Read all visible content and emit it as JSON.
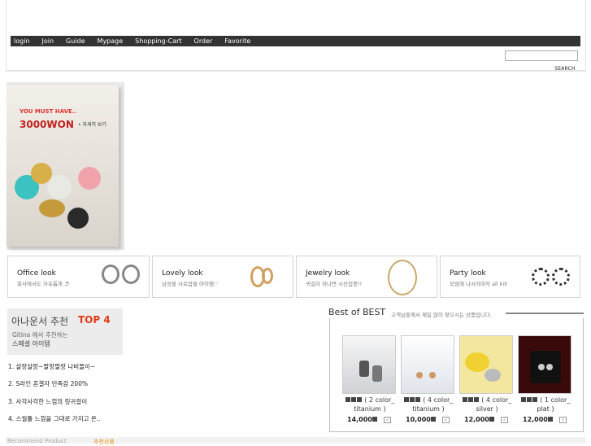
{
  "nav": {
    "items": [
      "login",
      "Join",
      "Guide",
      "Mypage",
      "Shopping-Cart",
      "Order",
      "Favorite"
    ]
  },
  "search": {
    "button_label": "SEARCH",
    "value": ""
  },
  "banner": {
    "tagline": "YOU MUST HAVE..",
    "price": "3000WON",
    "more": "• 자세히 보기"
  },
  "categories": [
    {
      "title": "Office look",
      "subtitle": "회사에서도 자유롭게 ♬"
    },
    {
      "title": "Lovely look",
      "subtitle": "남성을 사로잡을 아이템♡"
    },
    {
      "title": "Jewelry look",
      "subtitle": "귀걸이 하나면 시선집중!!"
    },
    {
      "title": "Party look",
      "subtitle": "모임에 나서자마자 all kill"
    }
  ],
  "announcer": {
    "title_a": "아나운서 추천",
    "title_b": "TOP 4",
    "sub1": "Gitina 에서 추천하는",
    "sub2": "스페셜 아이템",
    "items": [
      "1. 샬랑샬랑~팔랑팔랑 나비들이~",
      "2. S라인 흔결자 만족감 200%",
      "3. 사각사각한 느낌의 링귀걸이",
      "4. 스월톨 느낌을 그대로 가지고 온.."
    ]
  },
  "best": {
    "title": "Best of BEST",
    "subtitle": "고객님들께서 제일 많이 찾으시는 상품입니다.",
    "products": [
      {
        "name": "( 2 color_ titanium )",
        "price": "14,000"
      },
      {
        "name": "( 4 color_ titanium )",
        "price": "10,000"
      },
      {
        "name": "( 4 color_ silver )",
        "price": "12,000"
      },
      {
        "name": "( 1 color_ plat )",
        "price": "12,000"
      }
    ]
  },
  "recommend": {
    "label": "Recommend Product",
    "more": "추천상품"
  },
  "colors": {
    "nav_bg": "#333333",
    "accent_red": "#e03a17",
    "price_red": "#c0201e"
  }
}
